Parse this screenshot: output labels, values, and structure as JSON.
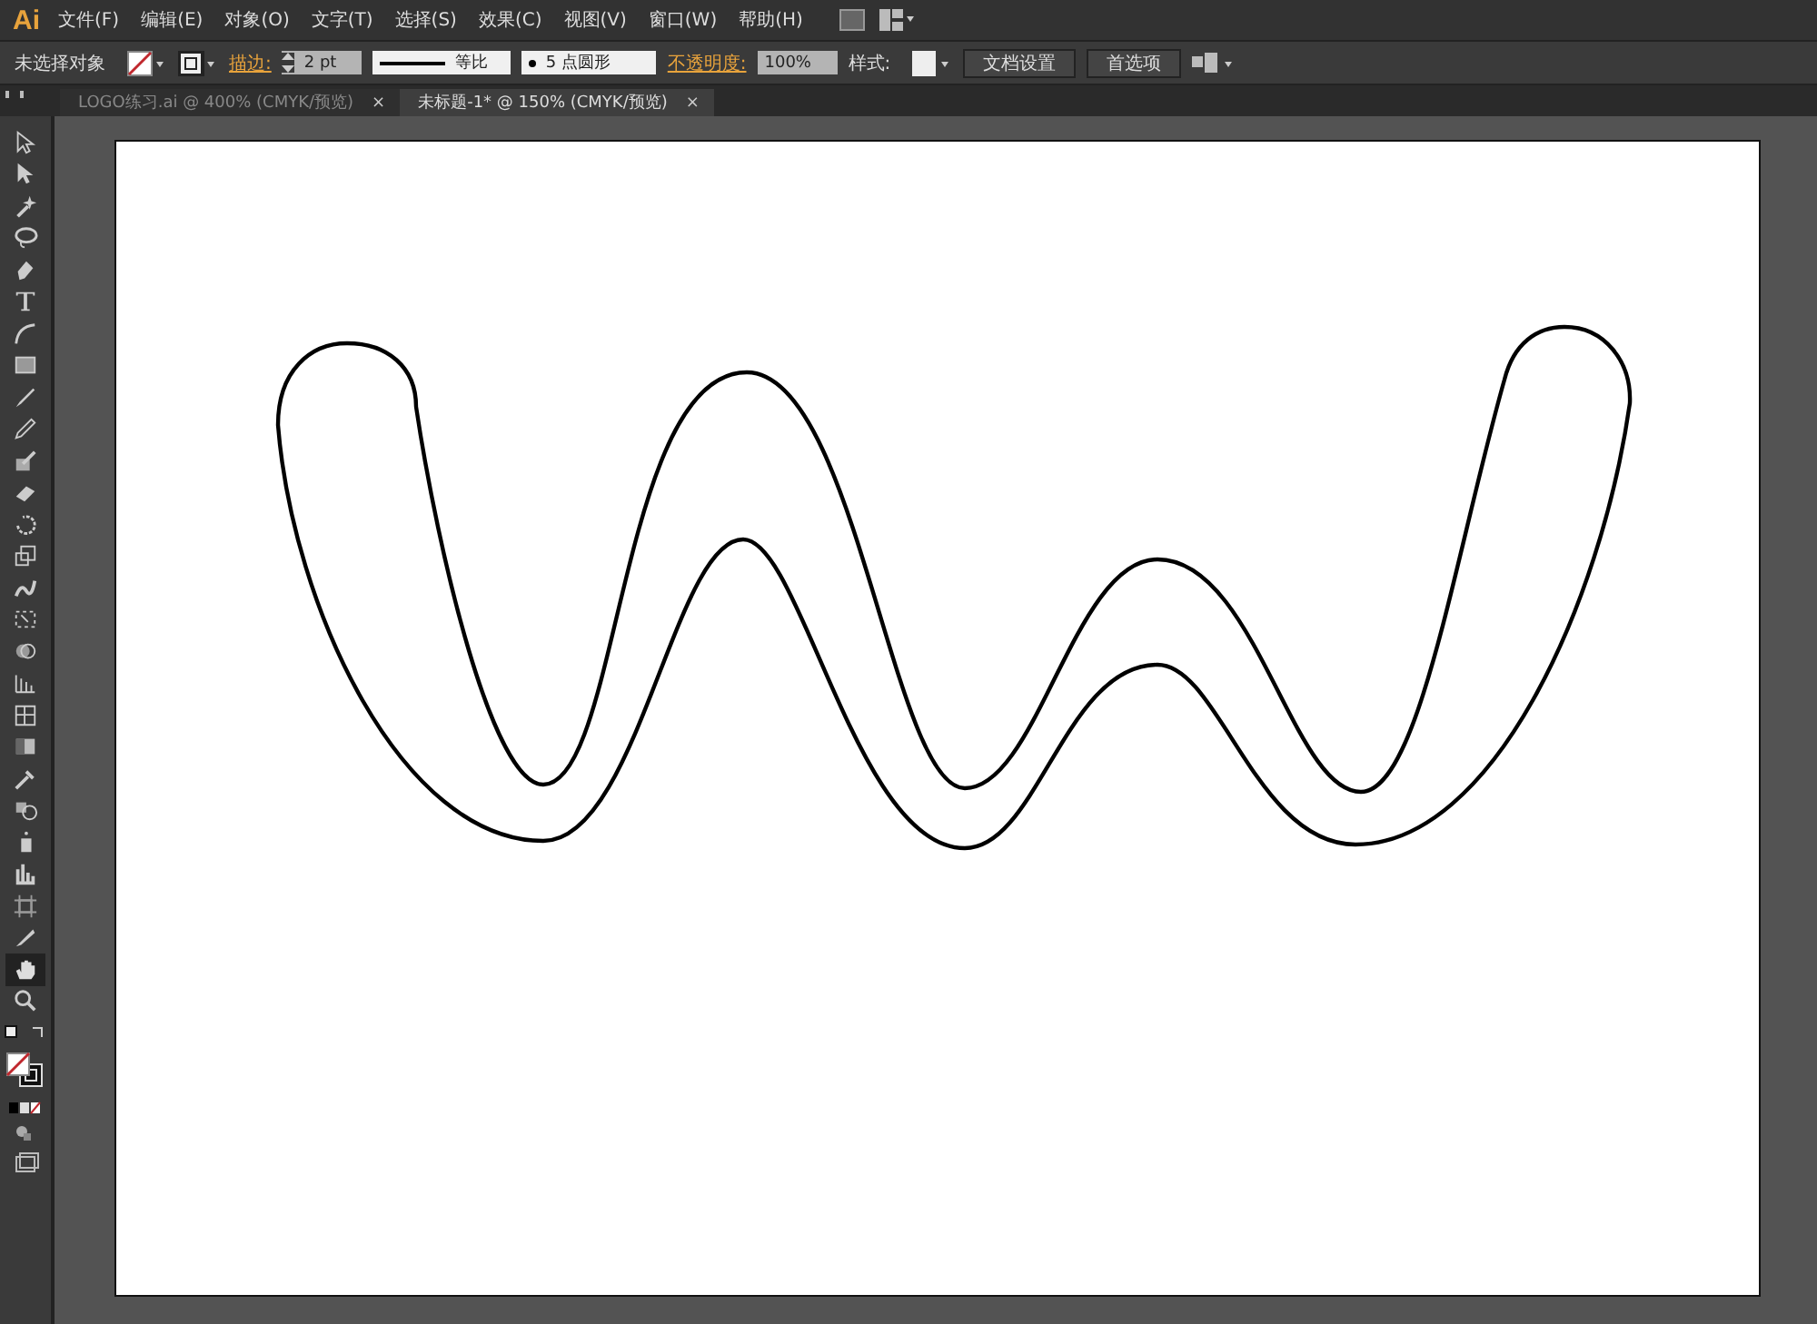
{
  "app_logo": "Ai",
  "menu": [
    "文件(F)",
    "编辑(E)",
    "对象(O)",
    "文字(T)",
    "选择(S)",
    "效果(C)",
    "视图(V)",
    "窗口(W)",
    "帮助(H)"
  ],
  "control_bar": {
    "selection_label": "未选择对象",
    "stroke_label": "描边:",
    "stroke_weight": "2 pt",
    "stroke_profile": "等比",
    "brush": "5 点圆形",
    "opacity_label": "不透明度:",
    "opacity": "100%",
    "style_label": "样式:",
    "buttons": [
      "文档设置",
      "首选项"
    ]
  },
  "tabs": [
    {
      "label": "LOGO练习.ai @ 400% (CMYK/预览)",
      "selected": false,
      "close": "×"
    },
    {
      "label": "未标题-1* @ 150% (CMYK/预览)",
      "selected": true,
      "close": "×"
    }
  ],
  "tools": [
    {
      "selected": false
    },
    {
      "selected": false
    },
    {
      "selected": false
    },
    {
      "selected": false
    },
    {
      "selected": false
    },
    {
      "selected": false
    },
    {
      "selected": false
    },
    {
      "selected": false
    },
    {
      "selected": false
    },
    {
      "selected": false
    },
    {
      "selected": false
    },
    {
      "selected": false
    },
    {
      "selected": false
    },
    {
      "selected": false
    },
    {
      "selected": false
    },
    {
      "selected": false
    },
    {
      "selected": false
    },
    {
      "selected": false
    },
    {
      "selected": false
    },
    {
      "selected": false
    },
    {
      "selected": false
    },
    {
      "selected": false
    },
    {
      "selected": false
    },
    {
      "selected": false
    },
    {
      "selected": false
    },
    {
      "selected": false
    },
    {
      "selected": true
    },
    {
      "selected": false
    }
  ]
}
